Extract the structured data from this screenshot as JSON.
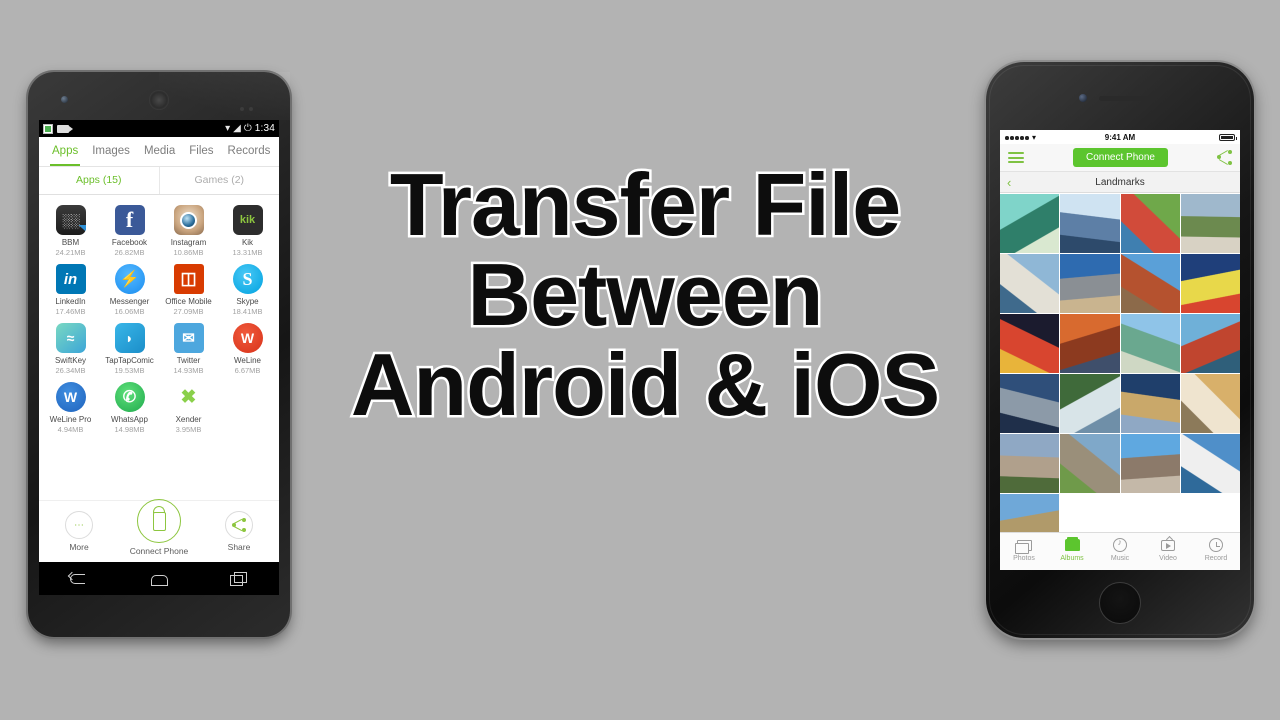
{
  "background_color": "#b3b3b3",
  "headline": {
    "lines": [
      "Transfer File",
      "Between",
      "Android & iOS"
    ],
    "text_color": "#0d0d0d",
    "outline_color": "#ffffff"
  },
  "android": {
    "status_bar": {
      "time": "1:34",
      "icons": [
        "spreadsheet-icon",
        "video-recorder-icon",
        "wifi-icon",
        "signal-icon",
        "battery-icon"
      ]
    },
    "tabs": [
      {
        "label": "Apps",
        "active": true
      },
      {
        "label": "Images",
        "active": false
      },
      {
        "label": "Media",
        "active": false
      },
      {
        "label": "Files",
        "active": false
      },
      {
        "label": "Records",
        "active": false
      }
    ],
    "sub_tabs": [
      {
        "label": "Apps (15)",
        "active": true
      },
      {
        "label": "Games (2)",
        "active": false
      }
    ],
    "accent_color": "#6bbf2a",
    "apps": [
      {
        "name": "BBM",
        "size": "24.21MB",
        "icon": "bbm-icon",
        "cls": "ic-bbm",
        "glyph": "░░"
      },
      {
        "name": "Facebook",
        "size": "26.82MB",
        "icon": "facebook-icon",
        "cls": "ic-fb",
        "glyph": "f"
      },
      {
        "name": "Instagram",
        "size": "10.86MB",
        "icon": "instagram-icon",
        "cls": "ic-ig",
        "glyph": ""
      },
      {
        "name": "Kik",
        "size": "13.31MB",
        "icon": "kik-icon",
        "cls": "ic-kik",
        "glyph": "kik"
      },
      {
        "name": "LinkedIn",
        "size": "17.46MB",
        "icon": "linkedin-icon",
        "cls": "ic-li",
        "glyph": "in"
      },
      {
        "name": "Messenger",
        "size": "16.06MB",
        "icon": "messenger-icon",
        "cls": "ic-msg",
        "glyph": "⚡"
      },
      {
        "name": "Office Mobile",
        "size": "27.09MB",
        "icon": "office-mobile-icon",
        "cls": "ic-off",
        "glyph": "◫"
      },
      {
        "name": "Skype",
        "size": "18.41MB",
        "icon": "skype-icon",
        "cls": "ic-sky",
        "glyph": "S"
      },
      {
        "name": "SwiftKey",
        "size": "26.34MB",
        "icon": "swiftkey-icon",
        "cls": "ic-swift",
        "glyph": "≈"
      },
      {
        "name": "TapTapComic",
        "size": "19.53MB",
        "icon": "taptapcomic-icon",
        "cls": "ic-ttc",
        "glyph": "◗"
      },
      {
        "name": "Twitter",
        "size": "14.93MB",
        "icon": "twitter-icon",
        "cls": "ic-tw",
        "glyph": "✉"
      },
      {
        "name": "WeLine",
        "size": "6.67MB",
        "icon": "weline-icon",
        "cls": "ic-wl",
        "glyph": "W"
      },
      {
        "name": "WeLine Pro",
        "size": "4.94MB",
        "icon": "weline-pro-icon",
        "cls": "ic-wlp",
        "glyph": "W"
      },
      {
        "name": "WhatsApp",
        "size": "14.98MB",
        "icon": "whatsapp-icon",
        "cls": "ic-wa",
        "glyph": "✆"
      },
      {
        "name": "Xender",
        "size": "3.95MB",
        "icon": "xender-icon",
        "cls": "ic-xen",
        "glyph": "✖"
      }
    ],
    "actions": {
      "more": "More",
      "connect": "Connect Phone",
      "share": "Share"
    },
    "nav_bar": [
      "back-button",
      "home-button",
      "recents-button"
    ]
  },
  "ios": {
    "status_bar": {
      "time": "9:41 AM"
    },
    "top_bar": {
      "menu": "hamburger-menu-icon",
      "connect_label": "Connect Phone",
      "share": "share-icon"
    },
    "nav_bar": {
      "back": "‹",
      "title": "Landmarks"
    },
    "accent_color": "#5cc52e",
    "photos": [
      {
        "label": "tropical-beach-kayaks",
        "c1": "#7fd4c9",
        "c2": "#2f7f6a",
        "c3": "#d9e8d0"
      },
      {
        "label": "snow-mountain-peak",
        "c1": "#cfe3f2",
        "c2": "#5d7fa6",
        "c3": "#2d4a6b"
      },
      {
        "label": "canal-market-boats",
        "c1": "#6fa84a",
        "c2": "#d14b3a",
        "c3": "#3f7fb0"
      },
      {
        "label": "city-skyline-park",
        "c1": "#9fb8cc",
        "c2": "#6c8a4f",
        "c3": "#d8d2c4"
      },
      {
        "label": "waterfront-highrise",
        "c1": "#8fb7d6",
        "c2": "#e3e0d6",
        "c3": "#3f6a8c"
      },
      {
        "label": "desert-highway-road",
        "c1": "#2e6bb0",
        "c2": "#8a8f94",
        "c3": "#c9b48f"
      },
      {
        "label": "red-rock-canyon-road",
        "c1": "#5aa0d8",
        "c2": "#b5522f",
        "c3": "#8c6a4a"
      },
      {
        "label": "las-vegas-sign",
        "c1": "#1f3f7a",
        "c2": "#e8d84a",
        "c3": "#d8452f"
      },
      {
        "label": "nashville-neon-street",
        "c1": "#1b1b2e",
        "c2": "#d8452f",
        "c3": "#e8b43a"
      },
      {
        "label": "red-desert-mesa",
        "c1": "#d86a2f",
        "c2": "#8c3a1f",
        "c3": "#3f4f6b"
      },
      {
        "label": "statue-of-liberty",
        "c1": "#8fc4e8",
        "c2": "#6aa88f",
        "c3": "#cfd8c4"
      },
      {
        "label": "golden-gate-bridge",
        "c1": "#6fb0d8",
        "c2": "#c0452f",
        "c3": "#2f5f7a"
      },
      {
        "label": "seattle-space-needle",
        "c1": "#2f4f7a",
        "c2": "#8c9aa8",
        "c3": "#1f2f4a"
      },
      {
        "label": "niagara-falls",
        "c1": "#3f6a3a",
        "c2": "#d8e4e8",
        "c3": "#6f8fa8"
      },
      {
        "label": "tower-bridge-london",
        "c1": "#1f3f6b",
        "c2": "#c9a86a",
        "c3": "#8fa8c4"
      },
      {
        "label": "taj-mahal",
        "c1": "#d8b06a",
        "c2": "#efe4cf",
        "c3": "#8c7a5a"
      },
      {
        "label": "mount-rushmore",
        "c1": "#8fa8c4",
        "c2": "#b0a08c",
        "c3": "#4f6b3a"
      },
      {
        "label": "stonehenge",
        "c1": "#7fa8c9",
        "c2": "#9a8f7a",
        "c3": "#6f9a4a"
      },
      {
        "label": "eiffel-tower-paris",
        "c1": "#5fa8e0",
        "c2": "#8c7a6a",
        "c3": "#c4b8a8"
      },
      {
        "label": "sydney-opera-house",
        "c1": "#4f8fc9",
        "c2": "#efefef",
        "c3": "#2f6a9a"
      },
      {
        "label": "colosseum-rome",
        "c1": "#6fa8d8",
        "c2": "#b09a6a",
        "c3": "#8c7a5a"
      }
    ],
    "tabs": [
      {
        "label": "Photos",
        "icon": "photos-icon",
        "active": false
      },
      {
        "label": "Albums",
        "icon": "albums-icon",
        "active": true
      },
      {
        "label": "Music",
        "icon": "music-icon",
        "active": false
      },
      {
        "label": "Video",
        "icon": "video-icon",
        "active": false
      },
      {
        "label": "Record",
        "icon": "record-icon",
        "active": false
      }
    ]
  }
}
